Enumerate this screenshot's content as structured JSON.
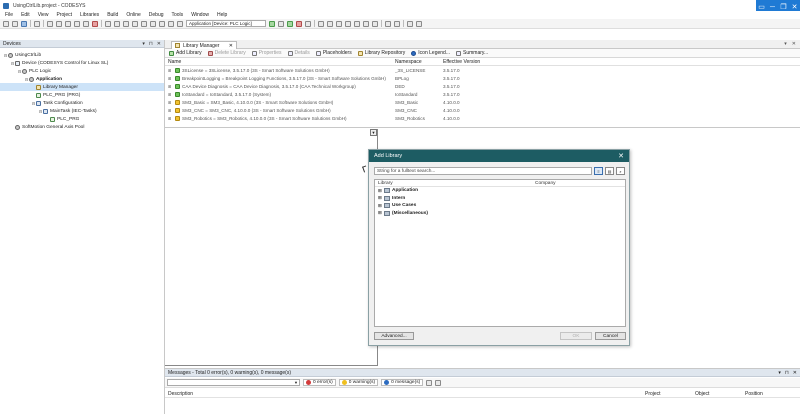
{
  "window": {
    "title": "UsingCtrlLib.project - CODESYS",
    "controls": [
      "▭",
      "─",
      "❐",
      "✕"
    ]
  },
  "menu": [
    "File",
    "Edit",
    "View",
    "Project",
    "Libraries",
    "Build",
    "Online",
    "Debug",
    "Tools",
    "Window",
    "Help"
  ],
  "toolbar": {
    "application_combo": "Application [Device: PLC Logic]"
  },
  "devices": {
    "title": "Devices",
    "ctrls": [
      "▾",
      "⊓",
      "✕"
    ],
    "tree": [
      {
        "label": "UsingCtrlLib",
        "depth": 0,
        "exp": "⊟",
        "icon": "gear",
        "bold": false
      },
      {
        "label": "Device (CODESYS Control for Linux SL)",
        "depth": 1,
        "exp": "⊟",
        "icon": "plain",
        "bold": false
      },
      {
        "label": "PLC Logic",
        "depth": 2,
        "exp": "⊟",
        "icon": "gear",
        "bold": false
      },
      {
        "label": "Application",
        "depth": 3,
        "exp": "⊟",
        "icon": "gear",
        "bold": true
      },
      {
        "label": "Library Manager",
        "depth": 4,
        "exp": "",
        "icon": "lib",
        "bold": false,
        "selected": true
      },
      {
        "label": "PLC_PRG (PRG)",
        "depth": 4,
        "exp": "",
        "icon": "prog",
        "bold": false
      },
      {
        "label": "Task Configuration",
        "depth": 4,
        "exp": "⊟",
        "icon": "task",
        "bold": false
      },
      {
        "label": "MainTask (IEC-Tasks)",
        "depth": 5,
        "exp": "⊟",
        "icon": "task",
        "bold": false
      },
      {
        "label": "PLC_PRG",
        "depth": 6,
        "exp": "",
        "icon": "prog",
        "bold": false
      },
      {
        "label": "SoftMotion General Axis Pool",
        "depth": 1,
        "exp": "",
        "icon": "gear",
        "bold": false
      }
    ]
  },
  "libmgr": {
    "tab_label": "Library Manager",
    "tab_close": "✕",
    "right_ctrls": [
      "▾",
      "✕"
    ],
    "toolbar": [
      {
        "label": "Add Library",
        "icon": "add",
        "disabled": false
      },
      {
        "label": "Delete Library",
        "icon": "del",
        "disabled": true
      },
      {
        "label": "Properties",
        "icon": "plain",
        "disabled": true
      },
      {
        "label": "Details",
        "icon": "plain",
        "disabled": true
      },
      {
        "label": "Placeholders",
        "icon": "plain",
        "disabled": false
      },
      {
        "label": "Library Repository",
        "icon": "lib",
        "disabled": false
      },
      {
        "label": "Icon Legend...",
        "icon": "info",
        "disabled": false
      },
      {
        "label": "Summary...",
        "icon": "plain",
        "disabled": false
      }
    ],
    "columns": {
      "name": "Name",
      "namespace": "Namespace",
      "version": "Effective Version"
    },
    "rows": [
      {
        "name": "3SLicense = 3SLicense, 3.5.17.0 (3S - Smart Software Solutions GmbH)",
        "ns": "_3S_LICENSE",
        "ver": "3.5.17.0",
        "color": "green"
      },
      {
        "name": "BreakpointLogging = Breakpoint Logging Functions, 3.5.17.0 (3S - Smart Software Solutions GmbH)",
        "ns": "BPLog",
        "ver": "3.5.17.0",
        "color": "green"
      },
      {
        "name": "CAA Device Diagnosis = CAA Device Diagnosis, 3.5.17.0 (CAA Technical Workgroup)",
        "ns": "DED",
        "ver": "3.5.17.0",
        "color": "green"
      },
      {
        "name": "IoStandard = IoStandard, 3.5.17.0 (System)",
        "ns": "IoStandard",
        "ver": "3.5.17.0",
        "color": "green"
      },
      {
        "name": "SM3_Basic = SM3_Basic, 4.10.0.0 (3S - Smart Software Solutions GmbH)",
        "ns": "SM3_Basic",
        "ver": "4.10.0.0",
        "color": "yellow"
      },
      {
        "name": "SM3_CNC = SM3_CNC, 4.10.0.0 (3S - Smart Software Solutions GmbH)",
        "ns": "SM3_CNC",
        "ver": "4.10.0.0",
        "color": "yellow"
      },
      {
        "name": "SM3_Robotics = SM3_Robotics, 4.10.0.0 (3S - Smart Software Solutions GmbH)",
        "ns": "SM3_Robotics",
        "ver": "4.10.0.0",
        "color": "yellow"
      }
    ]
  },
  "dialog": {
    "title": "Add Library",
    "close": "✕",
    "search_placeholder": "String for a fulltext search...",
    "col_library": "Library",
    "col_company": "Company",
    "items": [
      "Application",
      "Intern",
      "Use Cases",
      "(Miscellaneous)"
    ],
    "advanced": "Advanced...",
    "ok": "OK",
    "cancel": "Cancel"
  },
  "messages": {
    "title": "Messages - Total 0 error(s), 0 warning(s), 0 message(s)",
    "ctrls": [
      "▾",
      "⊓",
      "✕"
    ],
    "errors": "0 error(s)",
    "warnings": "0 warning(s)",
    "infos": "0 message(s)",
    "columns": [
      "Description",
      "Project",
      "Object",
      "Position"
    ]
  },
  "colors": {
    "dialog_title": "#1d5c63",
    "selection": "#cde3f8",
    "accent": "#1f7ad4"
  }
}
